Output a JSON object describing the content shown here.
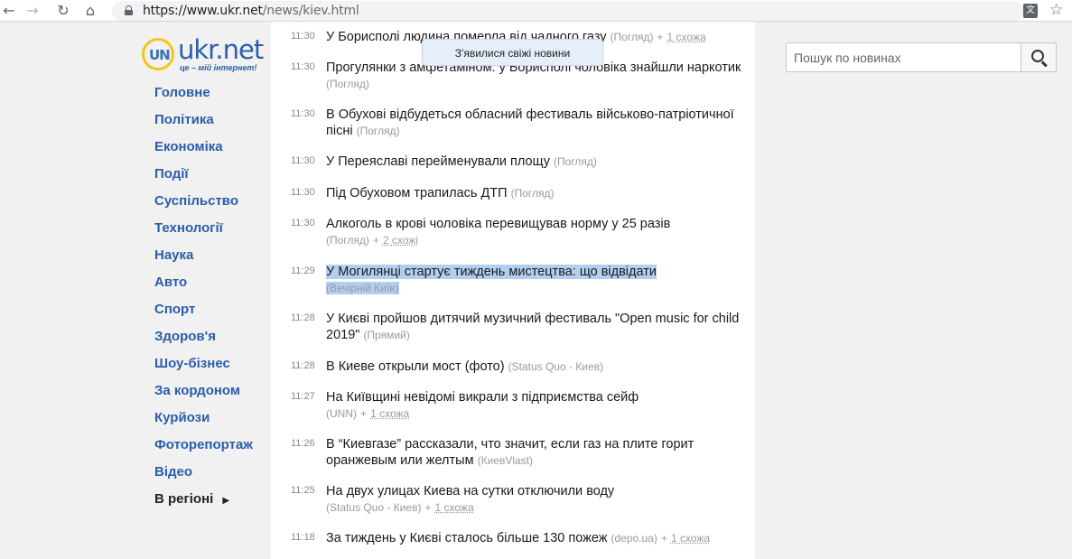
{
  "browser": {
    "url_host": "https://www.ukr.net",
    "url_path": "/news/kiev.html",
    "translate_label": "文"
  },
  "logo": {
    "mark": "UN",
    "name": "ukr.net",
    "tagline": "це – мій інтернет!"
  },
  "menu": [
    {
      "label": "Головне"
    },
    {
      "label": "Політика"
    },
    {
      "label": "Економіка"
    },
    {
      "label": "Події"
    },
    {
      "label": "Суспільство"
    },
    {
      "label": "Технології"
    },
    {
      "label": "Наука"
    },
    {
      "label": "Авто"
    },
    {
      "label": "Спорт"
    },
    {
      "label": "Здоров'я"
    },
    {
      "label": "Шоу-бізнес"
    },
    {
      "label": "За кордоном"
    },
    {
      "label": "Курйози"
    },
    {
      "label": "Фоторепортаж"
    },
    {
      "label": "Відео"
    }
  ],
  "region": {
    "label": "В регіоні",
    "arrow": "▶"
  },
  "fresh_news": "З'явилися свіжі новини",
  "search": {
    "placeholder": "Пошук по новинах"
  },
  "news": [
    {
      "time": "11:30",
      "title": "У Борисполі людина померла від чадного газу",
      "source": "(Погляд)",
      "similar_prefix": "+",
      "similar": "1 схожа"
    },
    {
      "time": "11:30",
      "title": "Прогулянки з амфетаміном: у Борисполі чоловіка знайшли наркотик",
      "source": "(Погляд)",
      "similar_prefix": "",
      "similar": ""
    },
    {
      "time": "11:30",
      "title": "В Обухові відбудеться обласний фестиваль військово-патріотичної пісні",
      "source": "(Погляд)",
      "similar_prefix": "",
      "similar": ""
    },
    {
      "time": "11:30",
      "title": "У Переяславі перейменували площу",
      "source": "(Погляд)",
      "similar_prefix": "",
      "similar": ""
    },
    {
      "time": "11:30",
      "title": "Під Обуховом трапилась ДТП",
      "source": "(Погляд)",
      "similar_prefix": "",
      "similar": ""
    },
    {
      "time": "11:30",
      "title": "Алкоголь в крові чоловіка перевищував норму у 25 разів",
      "source": "(Погляд)",
      "similar_prefix": "+",
      "similar": "2 схожі"
    },
    {
      "time": "11:29",
      "title": "У Могилянці стартує тиждень мистецтва: що відвідати",
      "source": "(Вечірній Київ)",
      "similar_prefix": "",
      "similar": ""
    },
    {
      "time": "11:28",
      "title": "У Києві пройшов дитячий музичний фестиваль \"Open music for child 2019\"",
      "source": "(Прямий)",
      "similar_prefix": "",
      "similar": ""
    },
    {
      "time": "11:28",
      "title": "В Киеве открыли мост (фото)",
      "source": "(Status Quo - Киев)",
      "similar_prefix": "",
      "similar": ""
    },
    {
      "time": "11:27",
      "title": "На Київщині невідомі викрали з підприємства сейф",
      "source": "(UNN)",
      "similar_prefix": "+",
      "similar": "1 схожа"
    },
    {
      "time": "11:26",
      "title": "В “Киевгазе” рассказали, что значит, если газ на плите горит оранжевым или желтым",
      "source": "(КиевVlast)",
      "similar_prefix": "",
      "similar": ""
    },
    {
      "time": "11:25",
      "title": "На двух улицах Киева на сутки отключили воду",
      "source": "(Status Quo - Киев)",
      "similar_prefix": "+",
      "similar": "1 схожа"
    },
    {
      "time": "11:18",
      "title": "За тиждень у Києві сталось більше 130 пожеж",
      "source": "(depo.ua)",
      "similar_prefix": "+",
      "similar": "1 схожа"
    }
  ]
}
